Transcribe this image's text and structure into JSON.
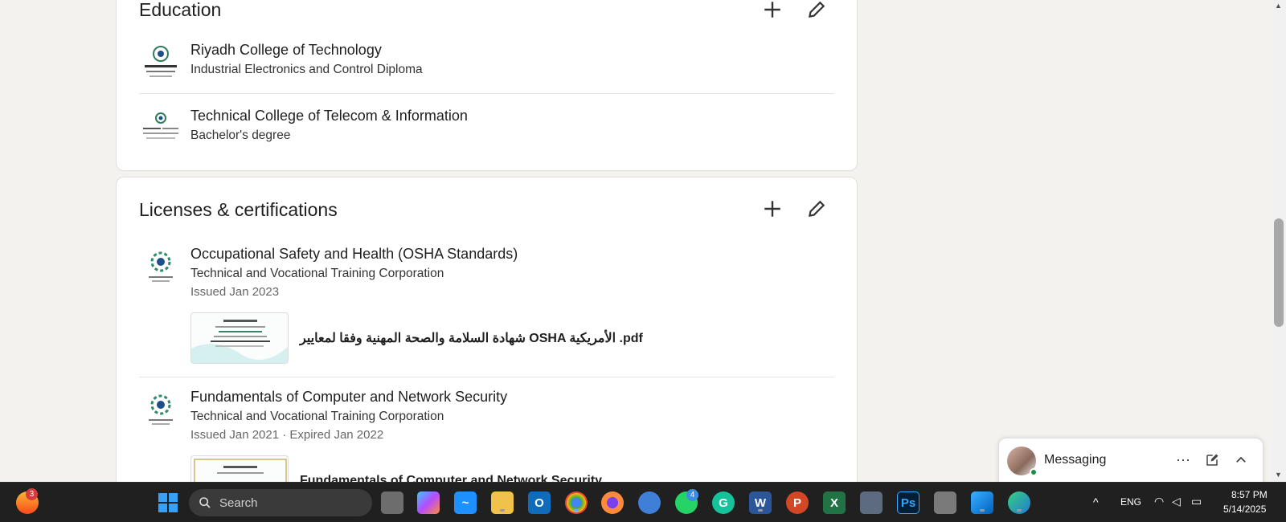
{
  "education": {
    "title": "Education",
    "items": [
      {
        "school": "Riyadh College of Technology",
        "degree": "Industrial Electronics and Control Diploma"
      },
      {
        "school": "Technical College of Telecom & Information",
        "degree": "Bachelor's degree"
      }
    ]
  },
  "licenses": {
    "title": "Licenses & certifications",
    "items": [
      {
        "name": "Occupational Safety and Health (OSHA Standards)",
        "issuer": "Technical and Vocational Training Corporation",
        "date": "Issued Jan 2023",
        "media_name": "شهادة السلامة والصحة المهنية وفقا لمعايير OSHA الأمريكية .pdf"
      },
      {
        "name": "Fundamentals of Computer and Network Security",
        "issuer": "Technical and Vocational Training Corporation",
        "date": "Issued Jan 2021 · Expired Jan 2022",
        "media_name": "Fundamentals of Computer and Network Security"
      }
    ]
  },
  "messaging": {
    "label": "Messaging"
  },
  "taskbar": {
    "weather_badge": "3",
    "search_placeholder": "Search",
    "whatsapp_badge": "4",
    "language": "ENG",
    "time": "8:57 PM",
    "date": "5/14/2025"
  },
  "colors": {
    "accent": "#0a66c2",
    "online": "#1c8a48"
  }
}
